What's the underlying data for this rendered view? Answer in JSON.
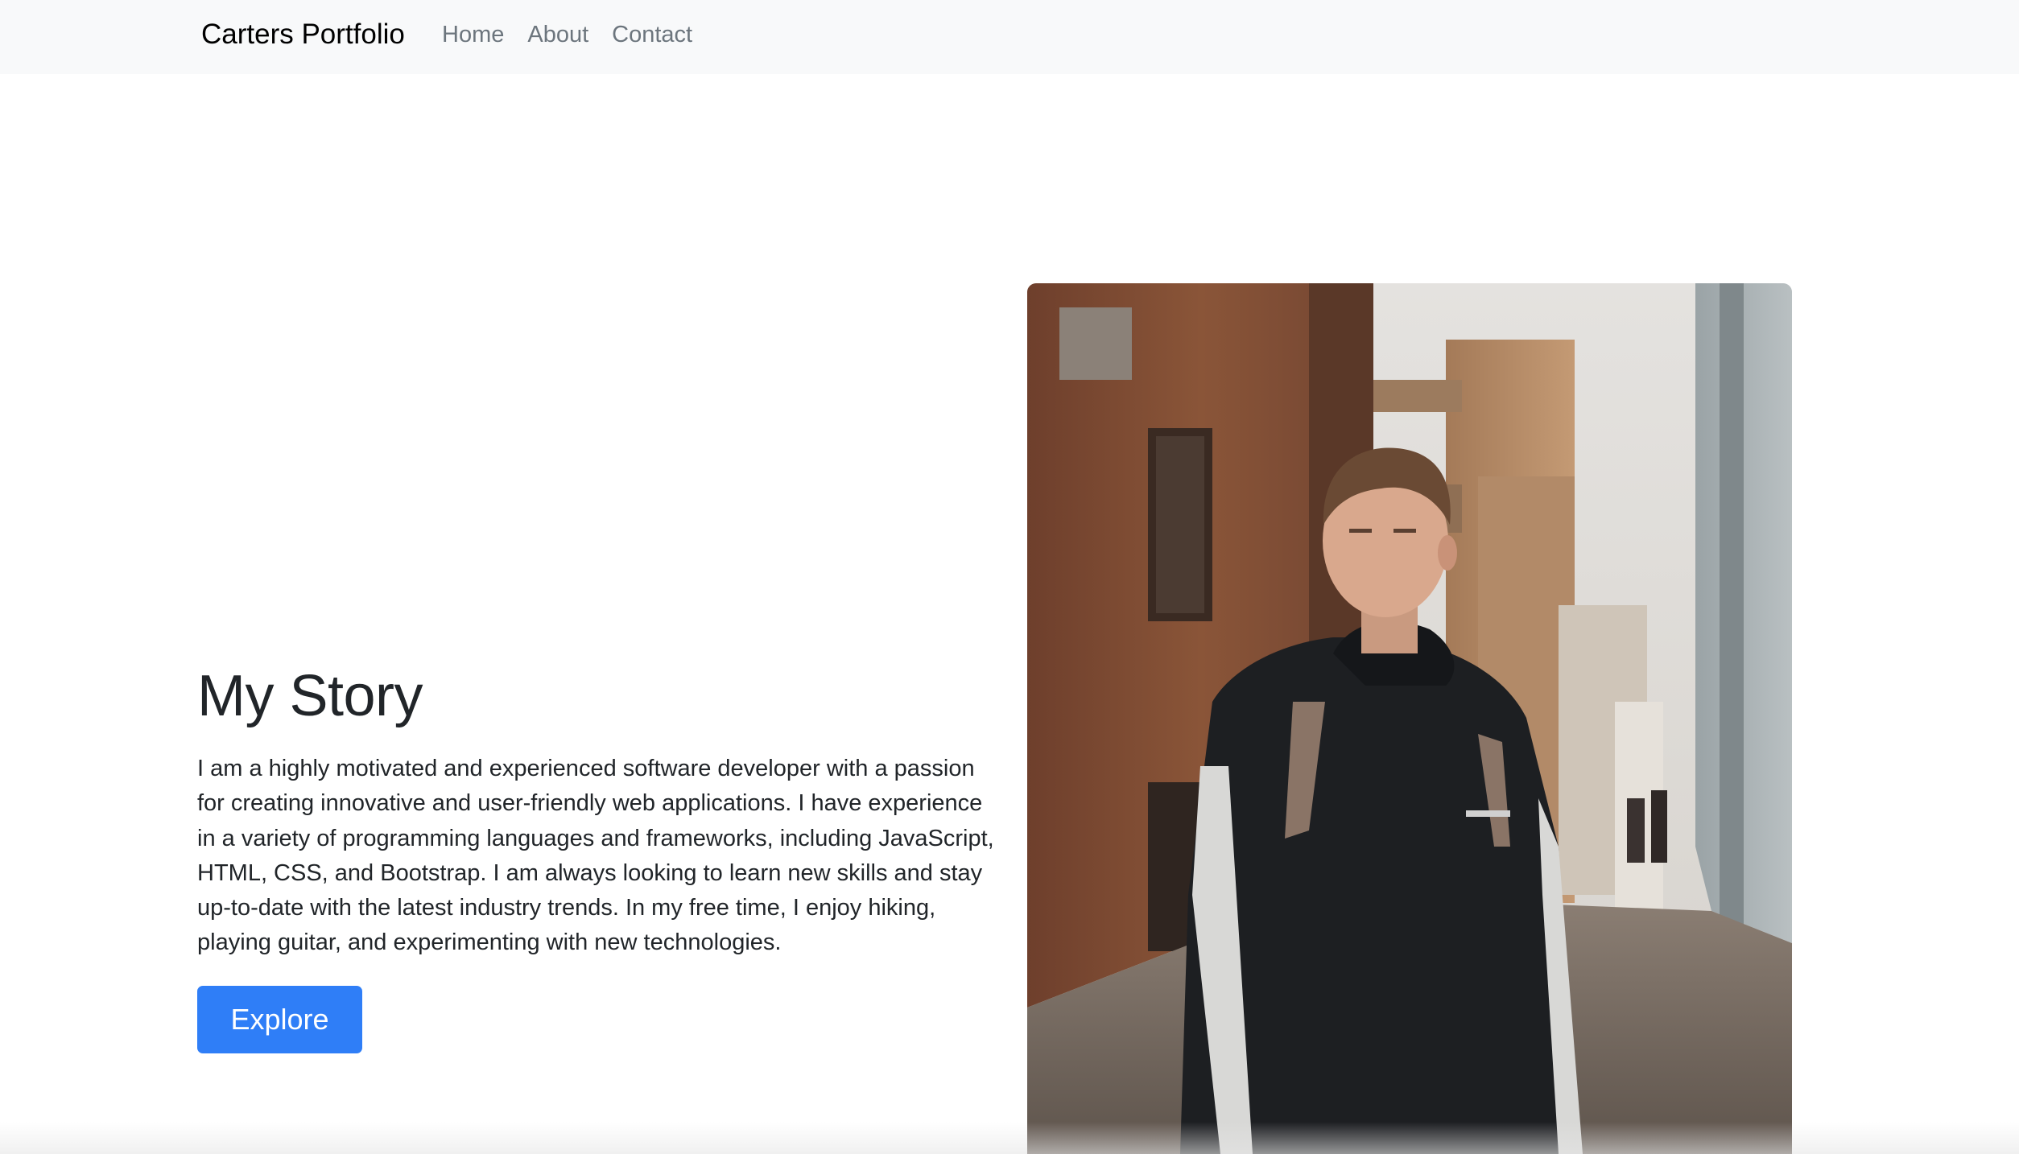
{
  "navbar": {
    "brand": "Carters Portfolio",
    "links": [
      {
        "label": "Home"
      },
      {
        "label": "About"
      },
      {
        "label": "Contact"
      }
    ]
  },
  "story": {
    "title": "My Story",
    "paragraph_lines": [
      "I am a highly motivated and experienced software developer with a passion",
      "for creating innovative and user-friendly web applications. I have experience",
      "in a variety of programming languages and frameworks, including JavaScript,",
      "HTML, CSS, and Bootstrap. I am always looking to learn new skills and stay",
      "up-to-date with the latest industry trends. In my free time, I enjoy hiking,",
      "playing guitar, and experimenting with new technologies."
    ],
    "button_label": "Explore"
  },
  "colors": {
    "navbar_bg": "#f8f9fa",
    "accent": "#2f7ef7",
    "text": "#212529",
    "nav_link": "#6c757d"
  }
}
